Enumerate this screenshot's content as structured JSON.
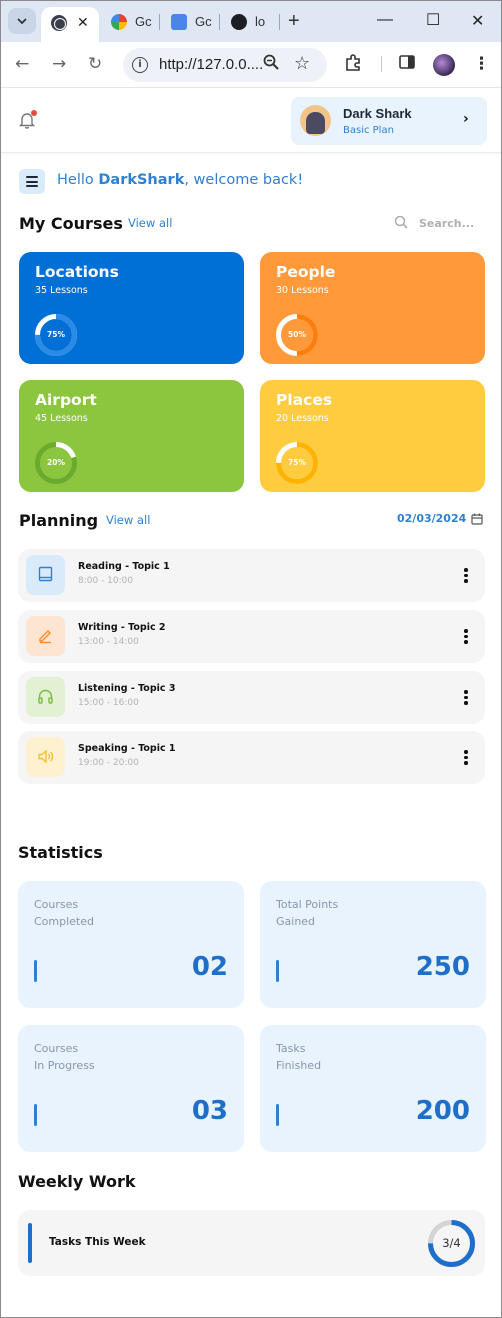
{
  "browser": {
    "tabs": [
      {
        "label": "Gc",
        "favicon": "google-icon"
      },
      {
        "label": "Gc",
        "favicon": "google-translate-icon"
      },
      {
        "label": "lo",
        "favicon": "github-icon"
      }
    ],
    "url": "http://127.0.0...."
  },
  "header": {
    "user_name": "Dark Shark",
    "user_plan": "Basic Plan",
    "notification_dot_color": "#e84a3b"
  },
  "greeting": {
    "prefix": "Hello ",
    "name": "DarkShark",
    "suffix": ", welcome back!"
  },
  "courses": {
    "title": "My Courses",
    "view_all": "View all",
    "search_placeholder": "Search...",
    "items": [
      {
        "title": "Locations",
        "lessons": "35 Lessons",
        "progress_label": "75%",
        "progress": 0.75,
        "color": "#0170d6",
        "track": "#ffffff",
        "fill": "#2b8ae5"
      },
      {
        "title": "People",
        "lessons": "30 Lessons",
        "progress_label": "50%",
        "progress": 0.5,
        "color": "#ff993a",
        "track": "#ffffff",
        "fill": "#ff7d0a"
      },
      {
        "title": "Airport",
        "lessons": "45 Lessons",
        "progress_label": "20%",
        "progress": 0.2,
        "color": "#8cc63e",
        "track": "#6aaa2e",
        "fill": "#ffffff"
      },
      {
        "title": "Places",
        "lessons": "20 Lessons",
        "progress_label": "75%",
        "progress": 0.75,
        "color": "#ffcc40",
        "track": "#ffffff",
        "fill": "#ffb300"
      }
    ]
  },
  "planning": {
    "title": "Planning",
    "view_all": "View all",
    "date": "02/03/2024",
    "items": [
      {
        "title": "Reading - Topic 1",
        "time": "8:00 - 10:00",
        "icon": "book-icon",
        "bg": "#d9ebfb",
        "color": "#2f80d1"
      },
      {
        "title": "Writing - Topic 2",
        "time": "13:00 - 14:00",
        "icon": "pencil-icon",
        "bg": "#fde5d2",
        "color": "#ff8a2a"
      },
      {
        "title": "Listening - Topic 3",
        "time": "15:00 - 16:00",
        "icon": "headphones-icon",
        "bg": "#e2f0d4",
        "color": "#7dbb3a"
      },
      {
        "title": "Speaking - Topic 1",
        "time": "19:00 - 20:00",
        "icon": "speaker-icon",
        "bg": "#fdf1d0",
        "color": "#f5c034"
      }
    ]
  },
  "statistics": {
    "title": "Statistics",
    "items": [
      {
        "line1": "Courses",
        "line2": "Completed",
        "value": "02"
      },
      {
        "line1": "Total Points",
        "line2": "Gained",
        "value": "250"
      },
      {
        "line1": "Courses",
        "line2": "In Progress",
        "value": "03"
      },
      {
        "line1": "Tasks",
        "line2": "Finished",
        "value": "200"
      }
    ]
  },
  "weekly": {
    "title": "Weekly Work",
    "label": "Tasks This Week",
    "progress_label": "3/4",
    "progress": 0.75,
    "color": "#1e6fc9"
  },
  "colors": {
    "accent": "#2f80d1",
    "accent_dark": "#1e6fc9",
    "card_light": "#e8f3fd"
  }
}
